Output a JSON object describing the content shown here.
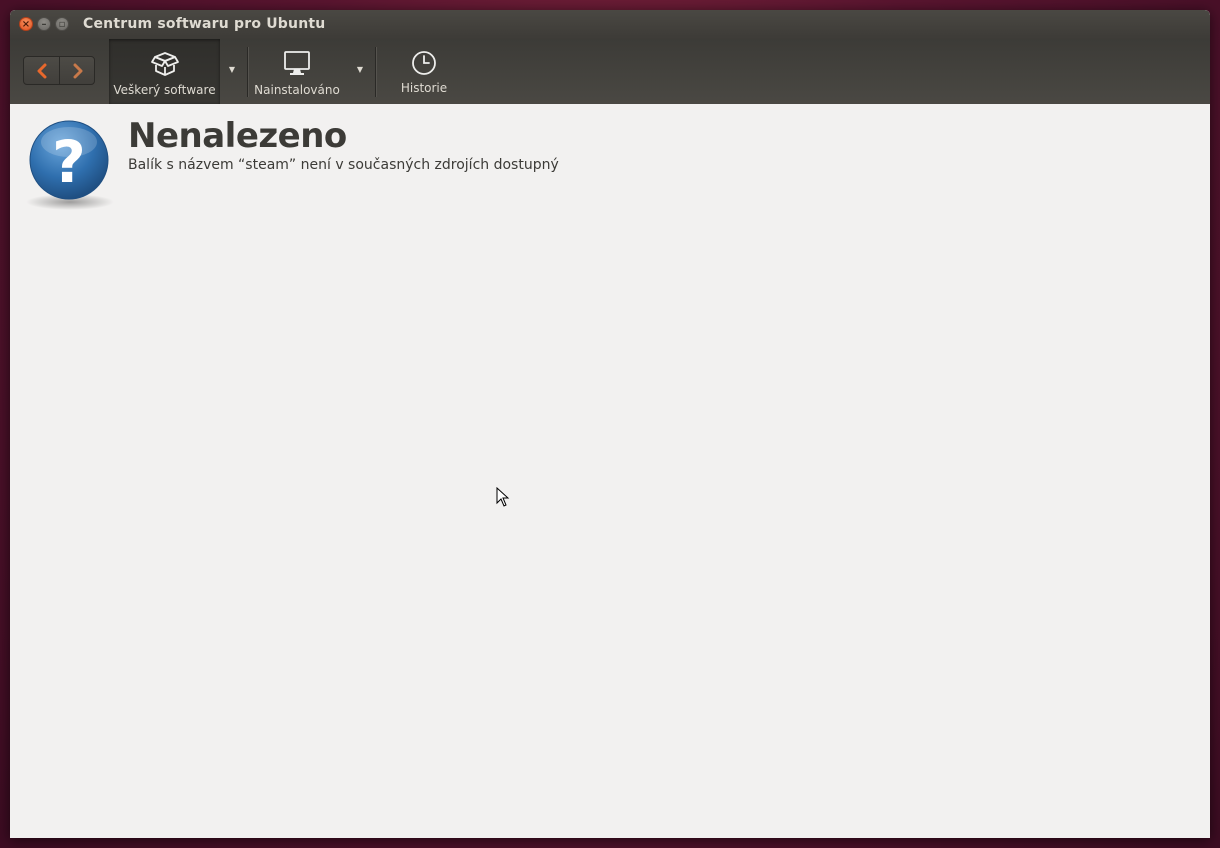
{
  "window": {
    "title": "Centrum softwaru pro Ubuntu",
    "controls": [
      "close-icon",
      "minimize-icon",
      "maximize-icon"
    ]
  },
  "toolbar": {
    "back_icon": "chevron-left-icon",
    "forward_icon": "chevron-right-icon",
    "items": [
      {
        "label": "Veškerý software",
        "icon": "box-icon",
        "active": true,
        "has_dropdown": true
      },
      {
        "label": "Nainstalováno",
        "icon": "monitor-icon",
        "active": false,
        "has_dropdown": true
      },
      {
        "label": "Historie",
        "icon": "clock-icon",
        "active": false,
        "has_dropdown": false
      }
    ]
  },
  "main": {
    "icon": "question-icon",
    "title": "Nenalezeno",
    "message": "Balík s názvem “steam” není v současných zdrojích dostupný"
  },
  "colors": {
    "accent_back": "#e8682c",
    "forward_arrow": "#c8794a",
    "close_button": "#e2511f",
    "toolbar_bg": "#3c3b37",
    "content_bg": "#f2f1f0",
    "text": "#3c3b37",
    "question_blue": "#2f6fae"
  }
}
